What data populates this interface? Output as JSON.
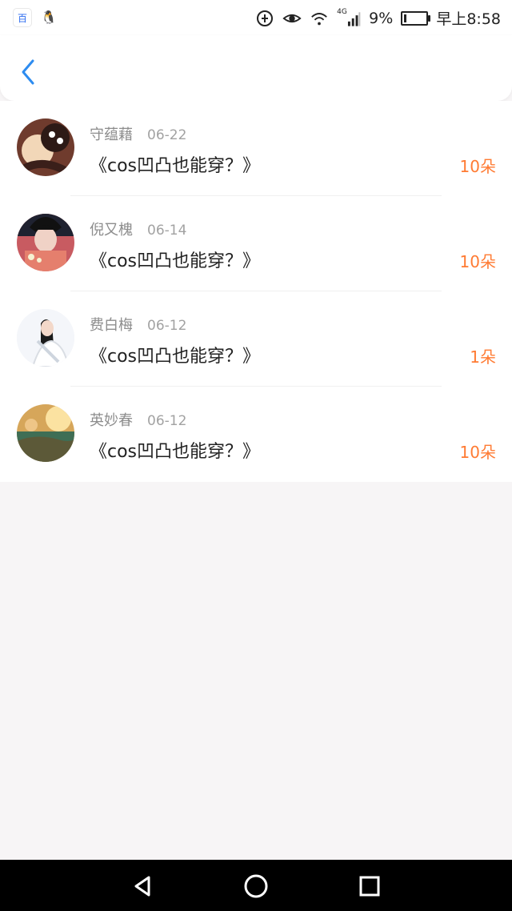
{
  "status_bar": {
    "left_icons": [
      {
        "name": "baidu-icon",
        "glyph": "百"
      },
      {
        "name": "qq-icon",
        "glyph": "🐧"
      }
    ],
    "battery_percent": "9%",
    "battery_level": 0.09,
    "time": "早上8:58",
    "network_label": "4G"
  },
  "colors": {
    "accent_blue": "#2d8cf0",
    "count_orange": "#ff7b33",
    "page_bg": "#f7f5f6"
  },
  "header": {
    "back_icon": "chevron-left-icon"
  },
  "list": {
    "items": [
      {
        "name": "守蕴藉",
        "date": "06-22",
        "title": "《cos凹凸也能穿？》",
        "count": "10朵"
      },
      {
        "name": "倪又槐",
        "date": "06-14",
        "title": "《cos凹凸也能穿？》",
        "count": "10朵"
      },
      {
        "name": "费白梅",
        "date": "06-12",
        "title": "《cos凹凸也能穿？》",
        "count": "1朵"
      },
      {
        "name": "英妙春",
        "date": "06-12",
        "title": "《cos凹凸也能穿？》",
        "count": "10朵"
      }
    ]
  },
  "nav": {
    "buttons": [
      {
        "name": "back-nav-icon"
      },
      {
        "name": "home-nav-icon"
      },
      {
        "name": "recents-nav-icon"
      }
    ]
  }
}
